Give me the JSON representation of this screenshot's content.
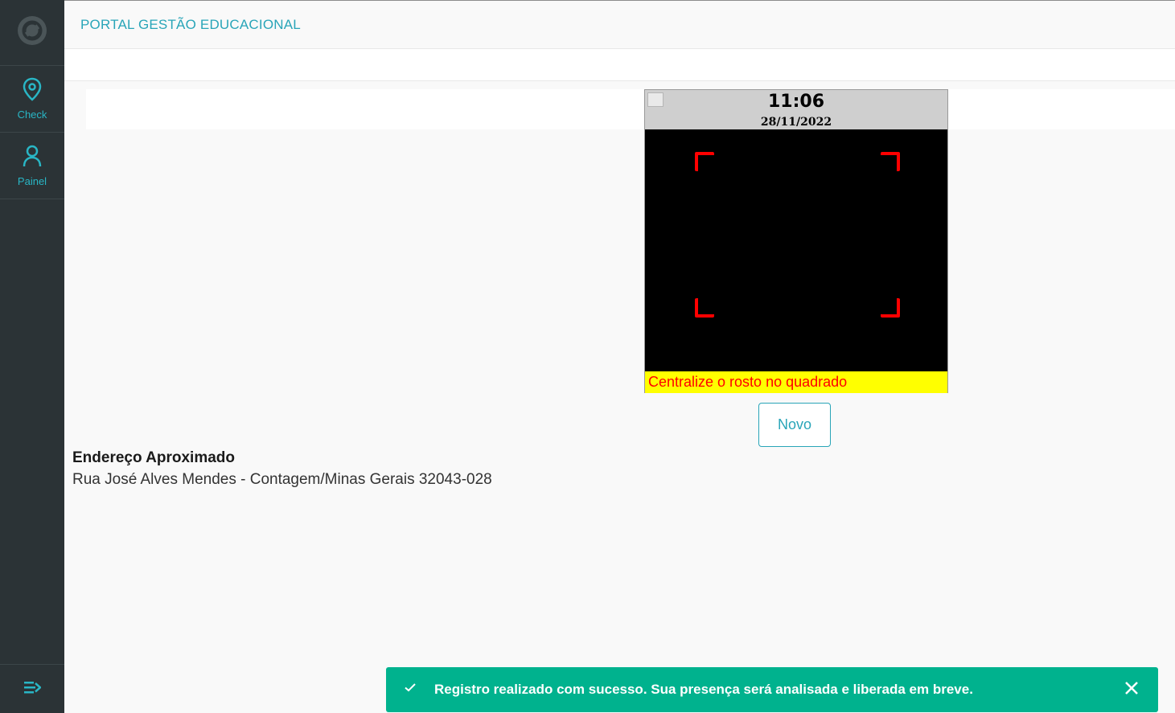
{
  "app": {
    "title": "PORTAL GESTÃO EDUCACIONAL"
  },
  "sidebar": {
    "logo_icon": "totvs-logo-icon",
    "items": [
      {
        "label": "Check",
        "icon": "location-pin-icon"
      },
      {
        "label": "Painel",
        "icon": "user-icon"
      }
    ],
    "bottom_icon": "expand-menu-icon"
  },
  "camera": {
    "time": "11:06",
    "date": "28/11/2022",
    "message": "Centralize o rosto no quadrado",
    "frame_color": "#ff0000",
    "message_bg": "#ffff00"
  },
  "actions": {
    "novo_label": "Novo"
  },
  "address": {
    "label": "Endereço Aproximado",
    "value": "Rua José Alves Mendes - Contagem/Minas Gerais 32043-028"
  },
  "toast": {
    "message": "Registro realizado com sucesso. Sua presença será analisada e liberada em breve.",
    "icon": "check-icon",
    "close_icon": "close-icon",
    "color": "#00b28e"
  },
  "colors": {
    "accent": "#29a5b8",
    "sidebar_bg": "#2b3336"
  }
}
